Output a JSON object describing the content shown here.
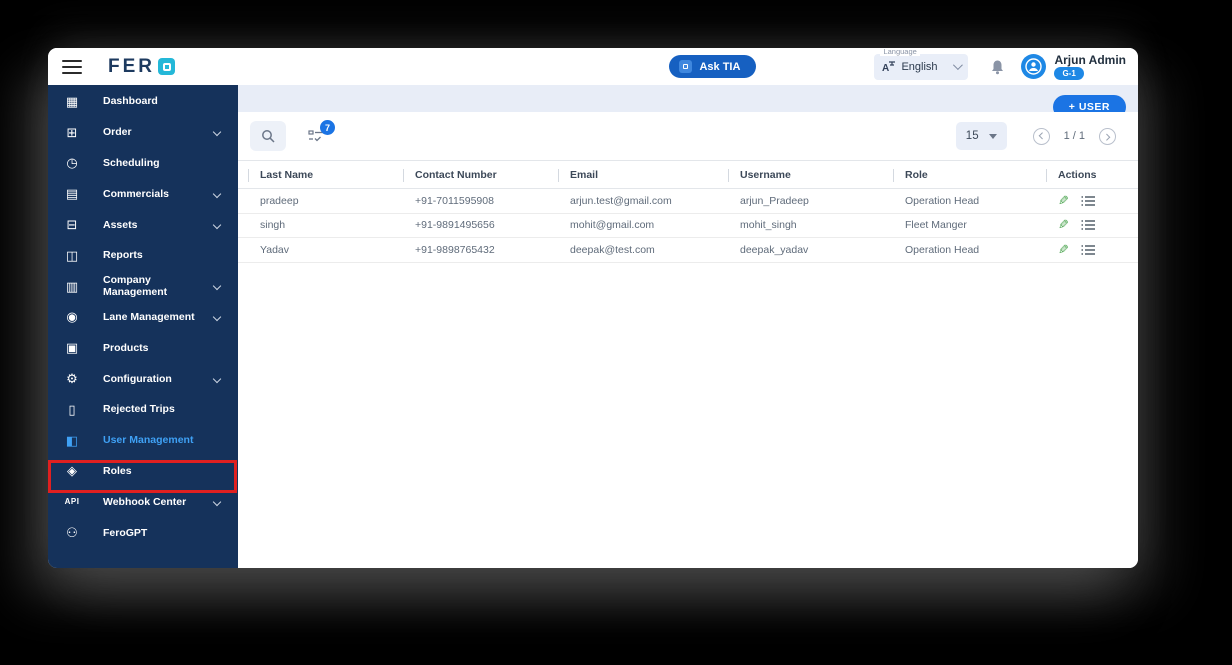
{
  "topbar": {
    "logo_text": "FER",
    "ask_tia_label": "Ask TIA",
    "language_label": "Language",
    "language_value": "English",
    "user_name": "Arjun Admin",
    "user_badge": "G-1"
  },
  "sidebar": {
    "items": [
      {
        "label": "Dashboard",
        "icon": "dashboard-icon",
        "glyph": "▦",
        "expandable": false,
        "active": false
      },
      {
        "label": "Order",
        "icon": "order-box-icon",
        "glyph": "⊞",
        "expandable": true,
        "active": false
      },
      {
        "label": "Scheduling",
        "icon": "scheduling-clock-icon",
        "glyph": "◷",
        "expandable": false,
        "active": false
      },
      {
        "label": "Commercials",
        "icon": "commercials-money-icon",
        "glyph": "▤",
        "expandable": true,
        "active": false
      },
      {
        "label": "Assets",
        "icon": "assets-truck-icon",
        "glyph": "⊟",
        "expandable": true,
        "active": false
      },
      {
        "label": "Reports",
        "icon": "reports-doc-icon",
        "glyph": "◫",
        "expandable": false,
        "active": false
      },
      {
        "label": "Company Management",
        "icon": "company-building-icon",
        "glyph": "▥",
        "expandable": true,
        "active": false
      },
      {
        "label": "Lane Management",
        "icon": "lane-route-icon",
        "glyph": "◉",
        "expandable": true,
        "active": false
      },
      {
        "label": "Products",
        "icon": "products-box-icon",
        "glyph": "▣",
        "expandable": false,
        "active": false
      },
      {
        "label": "Configuration",
        "icon": "configuration-gear-icon",
        "glyph": "⚙",
        "expandable": true,
        "active": false
      },
      {
        "label": "Rejected Trips",
        "icon": "rejected-trash-icon",
        "glyph": "▯",
        "expandable": false,
        "active": false
      },
      {
        "label": "User Management",
        "icon": "user-management-card-icon",
        "glyph": "◧",
        "expandable": false,
        "active": true
      },
      {
        "label": "Roles",
        "icon": "roles-shield-icon",
        "glyph": "◈",
        "expandable": false,
        "active": false
      },
      {
        "label": "Webhook Center",
        "icon": "webhook-api-icon",
        "glyph": "API",
        "expandable": true,
        "active": false
      },
      {
        "label": "FeroGPT",
        "icon": "ferogpt-bot-icon",
        "glyph": "⚇",
        "expandable": false,
        "active": false
      }
    ]
  },
  "content": {
    "add_user_label": "+  USER",
    "filter_badge": "7",
    "page_size": "15",
    "page_indicator": "1 / 1",
    "table": {
      "headers": [
        "Last Name",
        "Contact Number",
        "Email",
        "Username",
        "Role",
        "Actions"
      ],
      "rows": [
        {
          "last_name": "pradeep",
          "contact": "+91-7011595908",
          "email": "arjun.test@gmail.com",
          "username": "arjun_Pradeep",
          "role": "Operation Head"
        },
        {
          "last_name": "singh",
          "contact": "+91-9891495656",
          "email": "mohit@gmail.com",
          "username": "mohit_singh",
          "role": "Fleet Manger"
        },
        {
          "last_name": "Yadav",
          "contact": "+91-9898765432",
          "email": "deepak@test.com",
          "username": "deepak_yadav",
          "role": "Operation Head"
        }
      ]
    }
  },
  "colors": {
    "sidebar_navy": "#15325b",
    "accent_blue": "#1b74e4",
    "ask_tia_blue": "#1660c1",
    "active_link_blue": "#3fa1f5",
    "annotation_red": "#e02020",
    "edit_green": "#43a047",
    "badge_blue": "#1e88e5",
    "band_gray_blue": "#e8edf7",
    "logo_cyan": "#24b8d8"
  }
}
